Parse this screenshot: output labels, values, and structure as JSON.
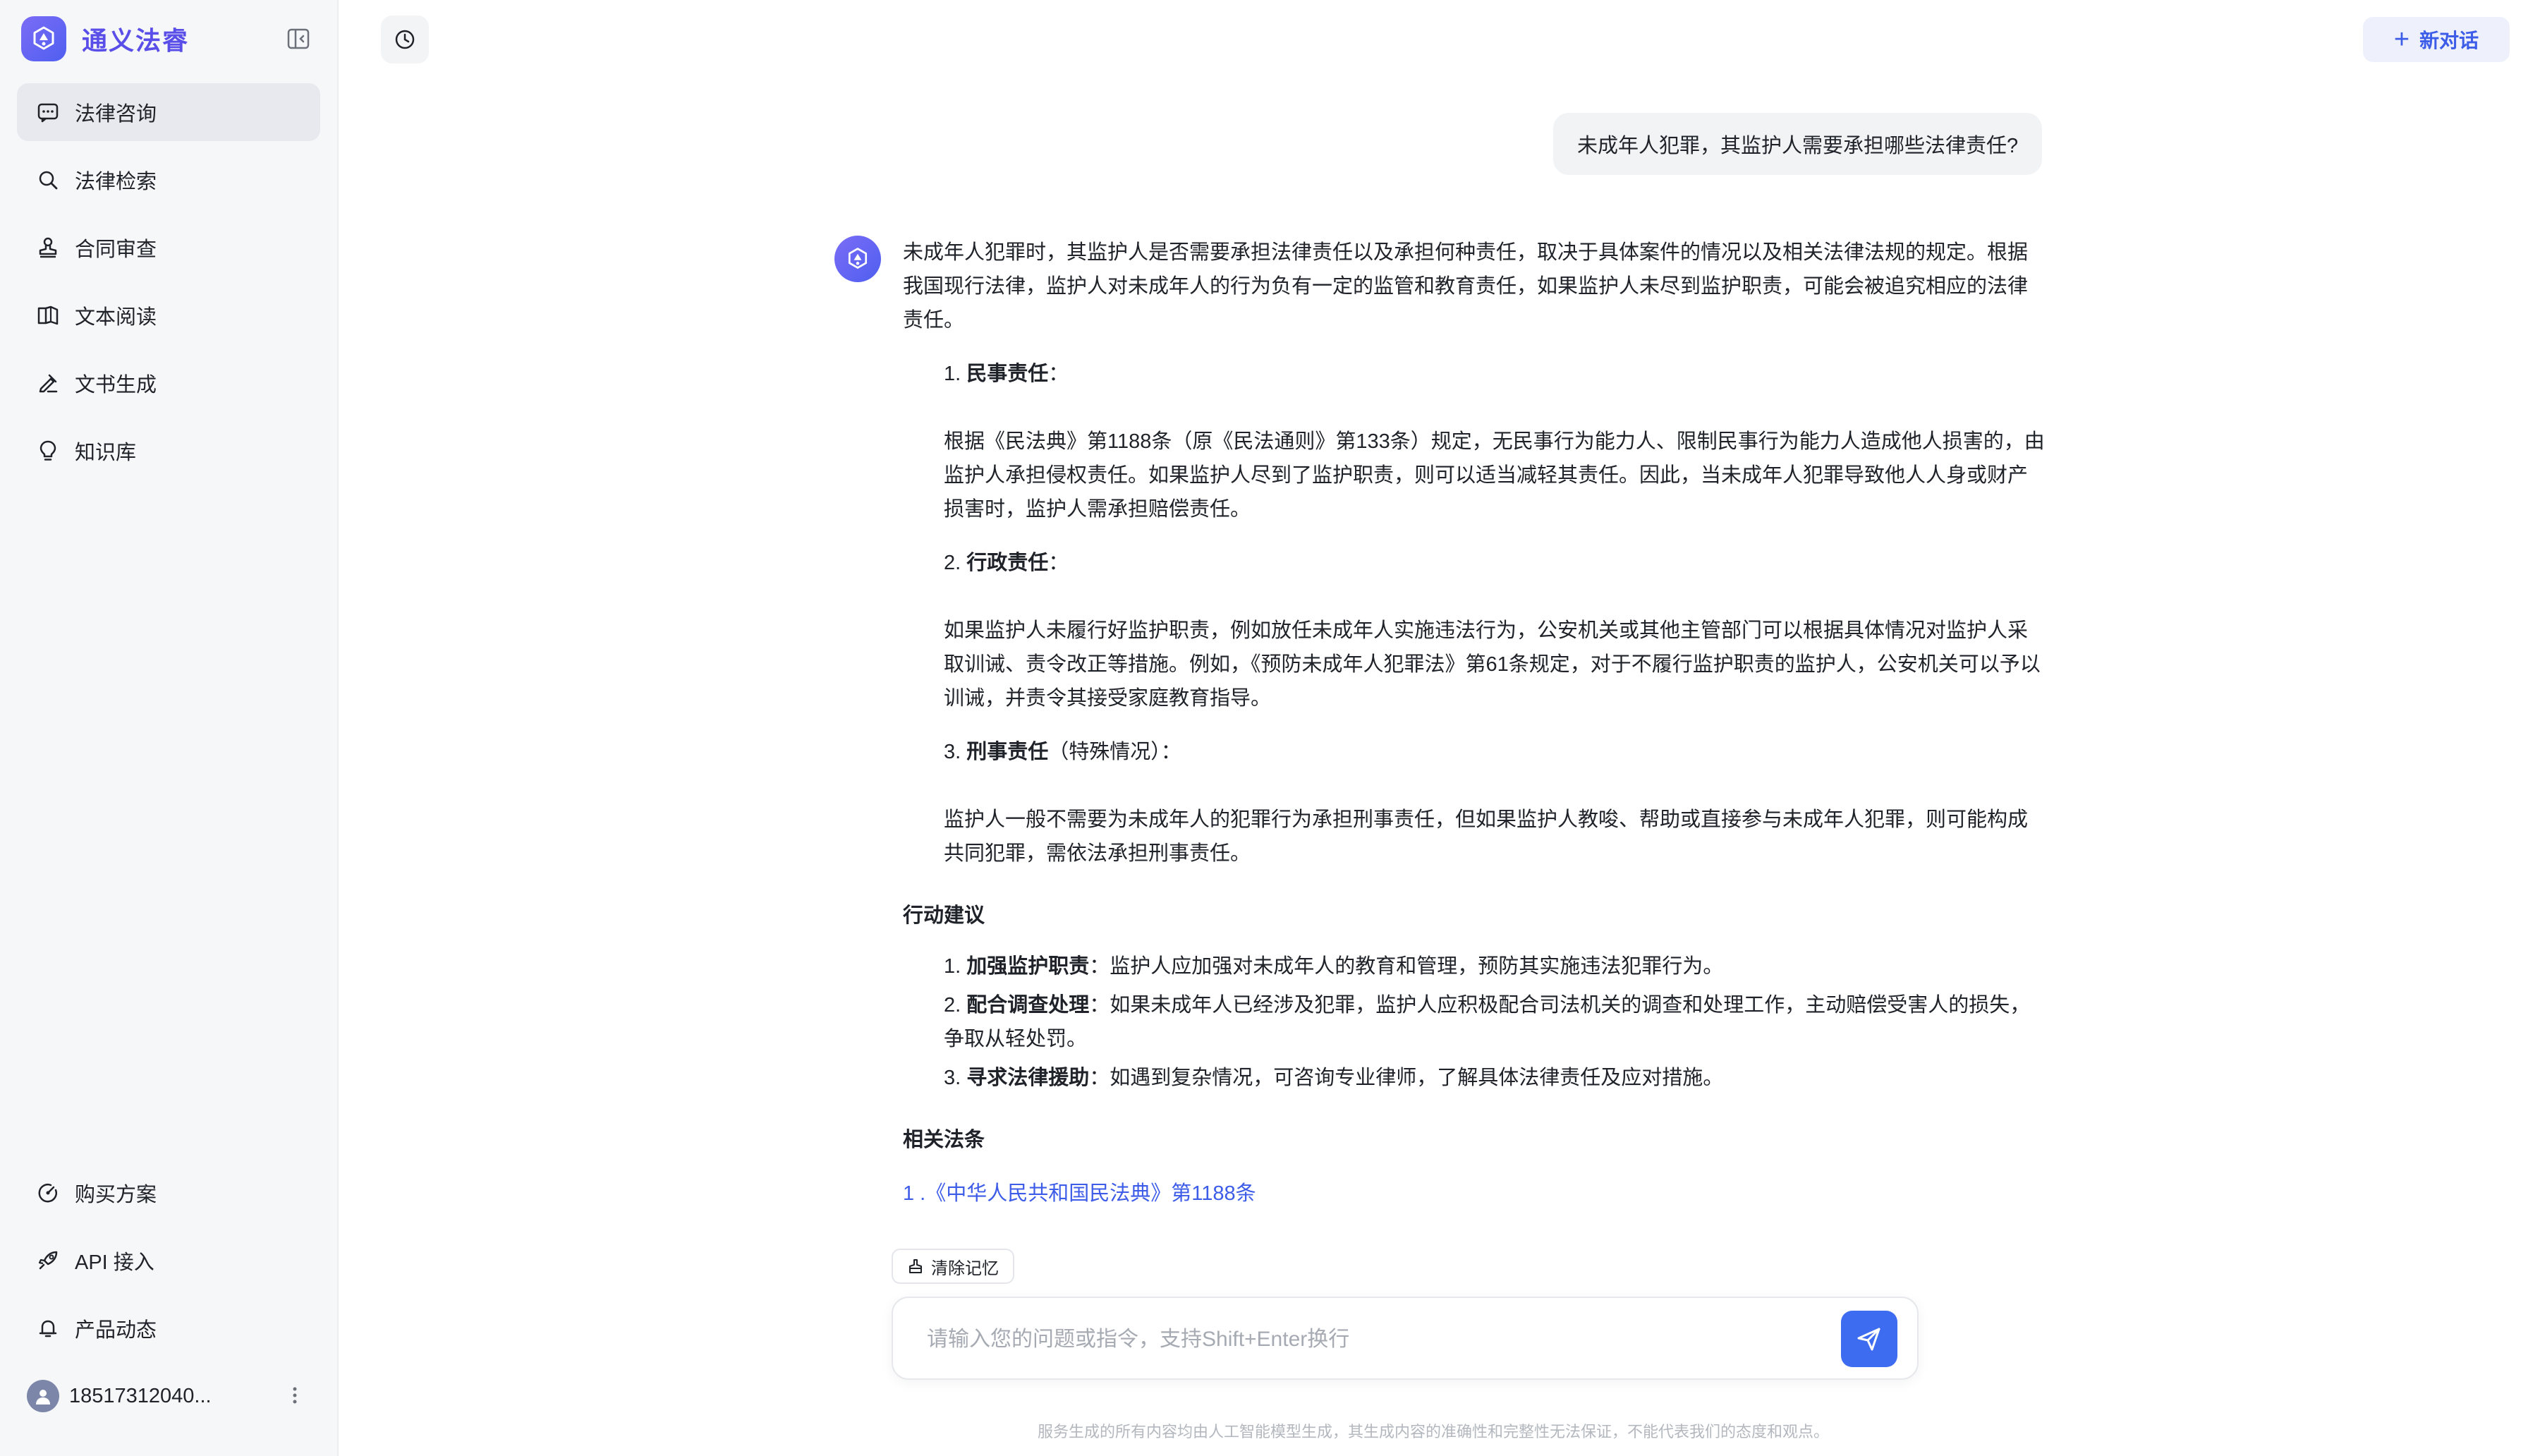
{
  "sidebar": {
    "brand": "通义法睿",
    "items": [
      {
        "label": "法律咨询",
        "icon": "chat-square-icon",
        "active": true
      },
      {
        "label": "法律检索",
        "icon": "search-icon",
        "active": false
      },
      {
        "label": "合同审查",
        "icon": "stamp-icon",
        "active": false
      },
      {
        "label": "文本阅读",
        "icon": "book-icon",
        "active": false
      },
      {
        "label": "文书生成",
        "icon": "pen-icon",
        "active": false
      },
      {
        "label": "知识库",
        "icon": "bulb-icon",
        "active": false
      }
    ],
    "bottom_items": [
      {
        "label": "购买方案",
        "icon": "gauge-icon"
      },
      {
        "label": "API 接入",
        "icon": "rocket-icon"
      },
      {
        "label": "产品动态",
        "icon": "bell-icon"
      }
    ],
    "user": {
      "name": "18517312040..."
    }
  },
  "header": {
    "new_chat": "新对话"
  },
  "conversation": {
    "question": "未成年人犯罪，其监护人需要承担哪些法律责任?",
    "answer": {
      "intro": "未成年人犯罪时，其监护人是否需要承担法律责任以及承担何种责任，取决于具体案件的情况以及相关法律法规的规定。根据我国现行法律，监护人对未成年人的行为负有一定的监管和教育责任，如果监护人未尽到监护职责，可能会被追究相应的法律责任。",
      "items": [
        {
          "num": "1.",
          "title": "民事责任",
          "suffix": "：",
          "body": "根据《民法典》第1188条（原《民法通则》第133条）规定，无民事行为能力人、限制民事行为能力人造成他人损害的，由监护人承担侵权责任。如果监护人尽到了监护职责，则可以适当减轻其责任。因此，当未成年人犯罪导致他人人身或财产损害时，监护人需承担赔偿责任。"
        },
        {
          "num": "2.",
          "title": "行政责任",
          "suffix": "：",
          "body": "如果监护人未履行好监护职责，例如放任未成年人实施违法行为，公安机关或其他主管部门可以根据具体情况对监护人采取训诫、责令改正等措施。例如，《预防未成年人犯罪法》第61条规定，对于不履行监护职责的监护人，公安机关可以予以训诫，并责令其接受家庭教育指导。"
        },
        {
          "num": "3.",
          "title": "刑事责任",
          "suffix": "（特殊情况）：",
          "body": "监护人一般不需要为未成年人的犯罪行为承担刑事责任，但如果监护人教唆、帮助或直接参与未成年人犯罪，则可能构成共同犯罪，需依法承担刑事责任。"
        }
      ],
      "actions_heading": "行动建议",
      "actions": [
        {
          "num": "1.",
          "title": "加强监护职责",
          "text": "：监护人应加强对未成年人的教育和管理，预防其实施违法犯罪行为。"
        },
        {
          "num": "2.",
          "title": "配合调查处理",
          "text": "：如果未成年人已经涉及犯罪，监护人应积极配合司法机关的调查和处理工作，主动赔偿受害人的损失，争取从轻处罚。"
        },
        {
          "num": "3.",
          "title": "寻求法律援助",
          "text": "：如遇到复杂情况，可咨询专业律师，了解具体法律责任及应对措施。"
        }
      ],
      "laws_heading": "相关法条",
      "laws": [
        "1 .《中华人民共和国民法典》第1188条"
      ]
    }
  },
  "composer": {
    "clear_memory": "清除记忆",
    "placeholder": "请输入您的问题或指令，支持Shift+Enter换行"
  },
  "disclaimer": "服务生成的所有内容均由人工智能模型生成，其生成内容的准确性和完整性无法保证，不能代表我们的态度和观点。",
  "colors": {
    "brand": "#5a4ee8",
    "accent": "#3d6cf0",
    "link": "#3d5ce8"
  }
}
